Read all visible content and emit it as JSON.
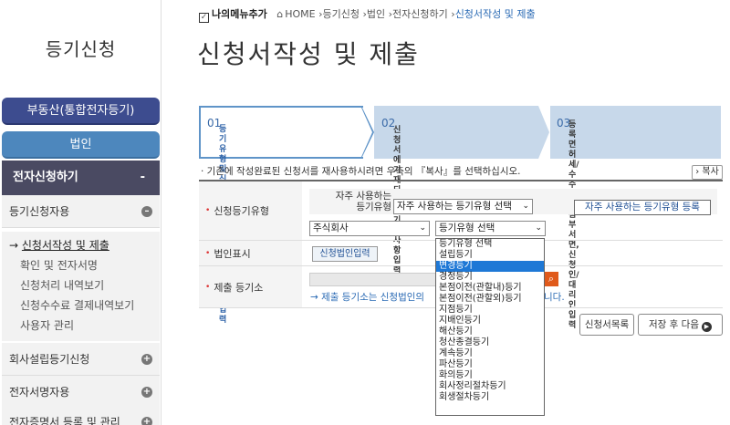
{
  "sidebar": {
    "title": "등기신청",
    "realestate": "부동산(통합전자등기)",
    "corporate": "법인",
    "ekey": "전자신청하기",
    "ekey_toggle": "-",
    "section_apply": "등기신청자용",
    "items": [
      "신청서작성 및 제출",
      "확인 및 전자서명",
      "신청처리 내역보기",
      "신청수수료 결제내역보기",
      "사용자 관리"
    ],
    "active_arrow": "→",
    "section_company": "회사설립등기신청",
    "section_esign": "전자서명자용",
    "section_cert": "전자증명서 등록 및 관리"
  },
  "breadcrumb": {
    "mymenu": "나의메뉴추가",
    "home": "HOME",
    "path": [
      "등기신청",
      "법인",
      "전자신청하기"
    ],
    "current": "신청서작성 및 제출",
    "sep": "›"
  },
  "page_title": "신청서작성 및 제출",
  "steps": [
    {
      "num": "01",
      "text1": "등기유형 및 신청법인, 제출 등기소,",
      "text2": "등기사유 입력"
    },
    {
      "num": "02",
      "text1": "신청서에 기재되는 등기할 사항 입력",
      "text2": ""
    },
    {
      "num": "03",
      "text1": "등록면허세/수수료 및 첨부서면,",
      "text2": "신청인/대리인 입력"
    }
  ],
  "notice": "· 기존에 작성완료된 신청서를 재사용하시려면 우측의 『복사』를 선택하십시오.",
  "copy_button": "복사",
  "form": {
    "req_mark": "•",
    "label_type": "신청등기유형",
    "frequent_label1": "자주 사용하는",
    "frequent_label2": "등기유형",
    "frequent_select": "자주 사용하는 등기유형 선택",
    "frequent_register": "자주 사용하는 등기유형 등록",
    "corp_select": "주식회사",
    "type_select": "등기유형 선택",
    "label_corp": "법인표시",
    "corp_input_button": "신청법인입력",
    "label_office": "제출 등기소",
    "office_note": "→ 제출 등기소는 신청법인의",
    "office_note_tail": "니다."
  },
  "buttons": {
    "list": "신청서목록",
    "save_next": "저장 후 다음"
  },
  "dropdown": {
    "options": [
      "등기유형 선택",
      "설립등기",
      "변경등기",
      "경정등기",
      "본점이전(관할내)등기",
      "본점이전(관할외)등기",
      "지점등기",
      "지배인등기",
      "해산등기",
      "청산종결등기",
      "계속등기",
      "파산등기",
      "화의등기",
      "회사정리절차등기",
      "회생절차등기"
    ],
    "selected_index": 2
  },
  "colors": {
    "accent_blue": "#4d87bd",
    "navy": "#3d4c8f",
    "dark_bar": "#4a4a62",
    "dropdown_highlight": "#1e78d6"
  }
}
